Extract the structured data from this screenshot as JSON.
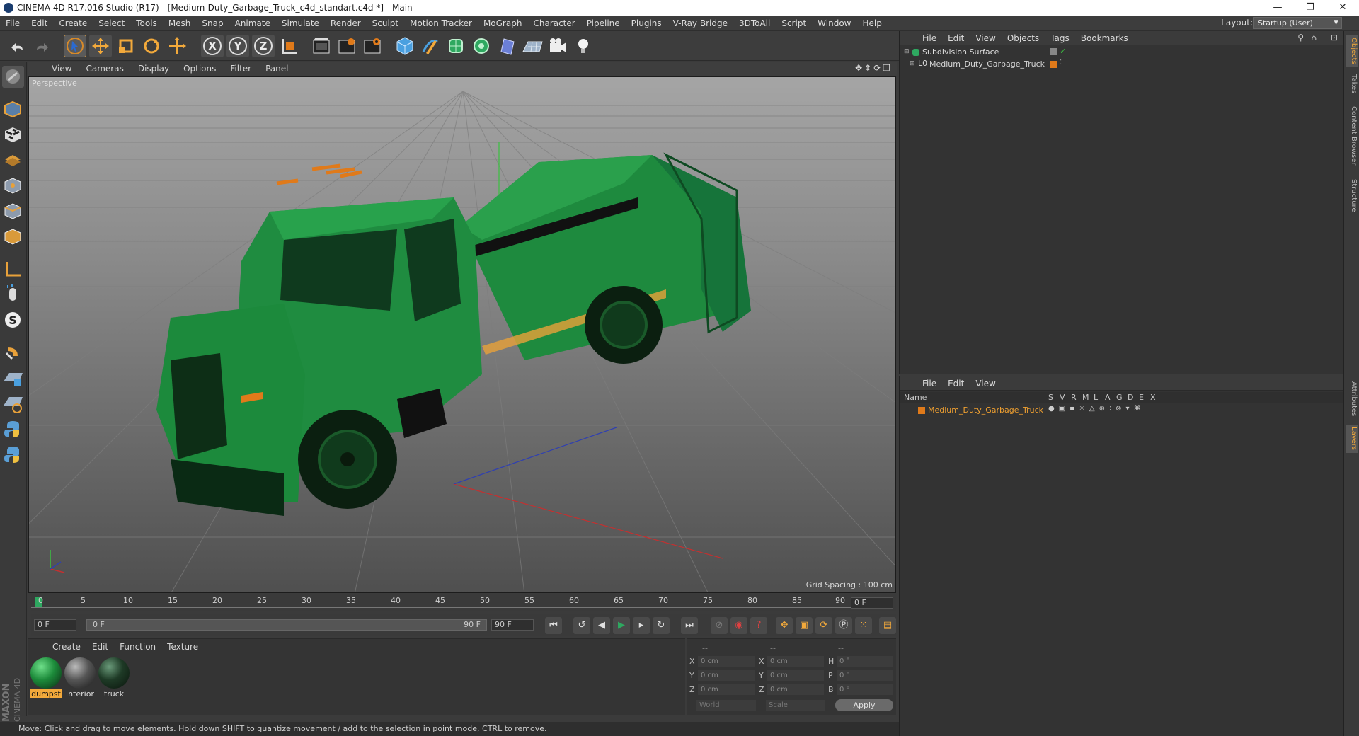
{
  "window": {
    "title": "CINEMA 4D R17.016 Studio (R17) - [Medium-Duty_Garbage_Truck_c4d_standart.c4d *] - Main",
    "minimize": "—",
    "restore": "❐",
    "close": "✕"
  },
  "menubar": {
    "items": [
      "File",
      "Edit",
      "Create",
      "Select",
      "Tools",
      "Mesh",
      "Snap",
      "Animate",
      "Simulate",
      "Render",
      "Sculpt",
      "Motion Tracker",
      "MoGraph",
      "Character",
      "Pipeline",
      "Plugins",
      "V-Ray Bridge",
      "3DToAll",
      "Script",
      "Window",
      "Help"
    ],
    "layout_label": "Layout:",
    "layout_value": "Startup (User)"
  },
  "toolbar": {
    "icons": [
      "undo-icon",
      "redo-icon",
      "select-icon",
      "move-icon",
      "scale-icon",
      "rotate-icon",
      "transform-icon",
      "x-axis-icon",
      "y-axis-icon",
      "z-axis-icon",
      "coord-system-icon",
      "render-view-icon",
      "render-picture-viewer-icon",
      "edit-render-settings-icon",
      "cube-icon",
      "pen-icon",
      "subdivision-icon",
      "mograph-cloner-icon",
      "deformer-icon",
      "floor-icon",
      "camera-icon",
      "light-icon"
    ],
    "axis_labels": [
      "X",
      "Y",
      "Z"
    ]
  },
  "left_toolbar": {
    "icons": [
      "model-mode-icon",
      "points-mode-icon",
      "texture-mode-icon",
      "edges-mode-icon",
      "polygons-mode-icon",
      "object-axis-icon",
      "uv-icon",
      "locator-icon",
      "snap-icon",
      "sculpt-icon",
      "magnet-icon",
      "grid-lock-icon",
      "grid-rotate-icon",
      "python-icon",
      "python2-icon"
    ]
  },
  "viewport": {
    "menu": [
      "View",
      "Cameras",
      "Display",
      "Options",
      "Filter",
      "Panel"
    ],
    "label": "Perspective",
    "grid_spacing": "Grid Spacing : 100 cm",
    "accent_green": "#1c8a3a"
  },
  "timeline": {
    "ticks": [
      "0",
      "5",
      "10",
      "15",
      "20",
      "25",
      "30",
      "35",
      "40",
      "45",
      "50",
      "55",
      "60",
      "65",
      "70",
      "75",
      "80",
      "85",
      "90"
    ],
    "end_frame": "0 F"
  },
  "transport": {
    "current_frame": "0 F",
    "range_start": "0 F",
    "range_end": "90 F",
    "max_frame": "90 F"
  },
  "materials": {
    "menu": [
      "Create",
      "Edit",
      "Function",
      "Texture"
    ],
    "items": [
      {
        "name": "dumpst",
        "selected": true
      },
      {
        "name": "interior",
        "selected": false
      },
      {
        "name": "truck",
        "selected": false
      }
    ]
  },
  "coords": {
    "headers": [
      "--",
      "--",
      "--"
    ],
    "rows": [
      {
        "a": "X",
        "av": "0 cm",
        "b": "X",
        "bv": "0 cm",
        "c": "H",
        "cv": "0 °"
      },
      {
        "a": "Y",
        "av": "0 cm",
        "b": "Y",
        "bv": "0 cm",
        "c": "P",
        "cv": "0 °"
      },
      {
        "a": "Z",
        "av": "0 cm",
        "b": "Z",
        "bv": "0 cm",
        "c": "B",
        "cv": "0 °"
      }
    ],
    "world": "World",
    "scale": "Scale",
    "apply": "Apply"
  },
  "status": {
    "text": "Move: Click and drag to move elements. Hold down SHIFT to quantize movement / add to the selection in point mode, CTRL to remove."
  },
  "object_manager": {
    "menu": [
      "File",
      "Edit",
      "View",
      "Objects",
      "Tags",
      "Bookmarks"
    ],
    "objects": [
      {
        "name": "Subdivision Surface",
        "color": "#e0e0e0"
      },
      {
        "name": "Medium_Duty_Garbage_Truck",
        "color": "#d6d6d6"
      }
    ]
  },
  "layer_manager": {
    "menu": [
      "File",
      "Edit",
      "View"
    ],
    "name_header": "Name",
    "columns": [
      "S",
      "V",
      "R",
      "M",
      "L",
      "A",
      "G",
      "D",
      "E",
      "X"
    ],
    "layer": {
      "name": "Medium_Duty_Garbage_Truck",
      "color": "#e07a1a"
    }
  },
  "right_tabs": [
    "Objects",
    "Takes",
    "Content Browser",
    "Structure",
    "Attributes",
    "Layers"
  ],
  "maxon": {
    "line1": "MAXON",
    "line2": "CINEMA 4D"
  }
}
